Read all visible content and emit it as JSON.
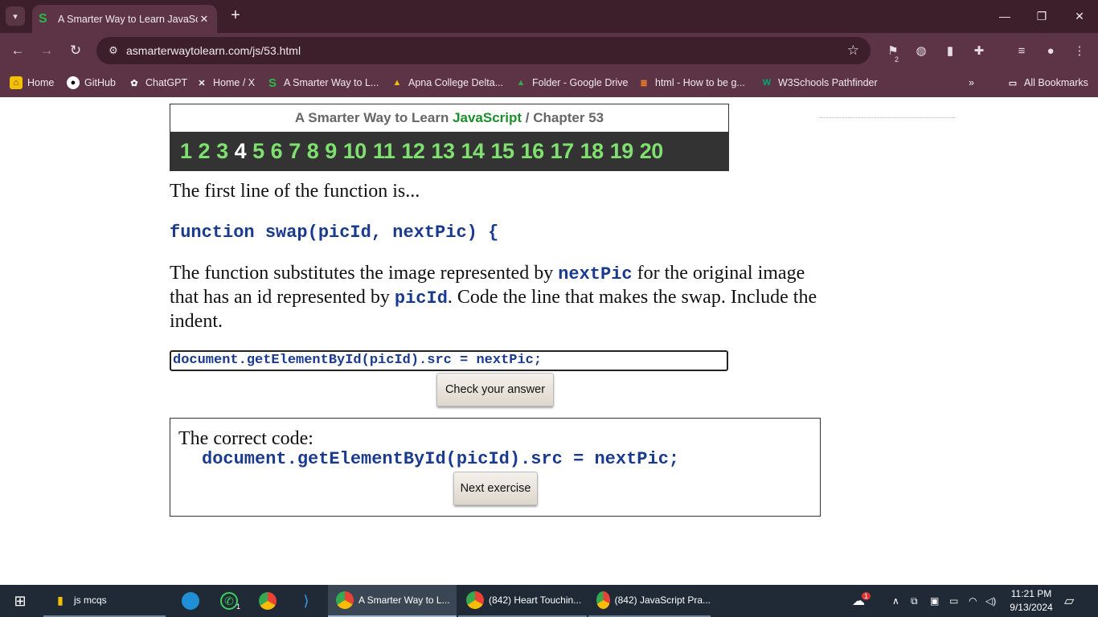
{
  "browser": {
    "tab": {
      "title": "A Smarter Way to Learn JavaScri",
      "favicon": "S"
    },
    "url": "asmarterwaytolearn.com/js/53.html",
    "bookmarks": [
      {
        "label": "Home",
        "icon": "home-icon"
      },
      {
        "label": "GitHub",
        "icon": "github-icon"
      },
      {
        "label": "ChatGPT",
        "icon": "chatgpt-icon"
      },
      {
        "label": "Home / X",
        "icon": "x-icon"
      },
      {
        "label": "A Smarter Way to L...",
        "icon": "smarter-way-icon"
      },
      {
        "label": "Apna College Delta...",
        "icon": "drive-icon"
      },
      {
        "label": "Folder - Google Drive",
        "icon": "drive-icon"
      },
      {
        "label": "html - How to be g...",
        "icon": "stackoverflow-icon"
      },
      {
        "label": "W3Schools Pathfinder",
        "icon": "w3schools-icon"
      }
    ],
    "all_bookmarks": "All Bookmarks",
    "extension_badge": "2"
  },
  "page": {
    "header_prefix": "A Smarter Way to Learn ",
    "header_js": "JavaScript",
    "header_sep": " / ",
    "header_chapter": "Chapter 53",
    "chapters": [
      "1",
      "2",
      "3",
      "4",
      "5",
      "6",
      "7",
      "8",
      "9",
      "10",
      "11",
      "12",
      "13",
      "14",
      "15",
      "16",
      "17",
      "18",
      "19",
      "20"
    ],
    "current_chapter": "4",
    "lead": "The first line of the function is...",
    "code_line": "function swap(picId, nextPic) {",
    "question_part1": "The function substitutes the image represented by ",
    "question_mono1": "nextPic",
    "question_part2": " for the original image that has an id represented by ",
    "question_mono2": "picId",
    "question_part3": ". Code the line that makes the swap. Include the indent.",
    "answer_value": "document.getElementById(picId).src = nextPic;",
    "check_button": "Check your answer",
    "result_label": "The correct code:",
    "result_code": "document.getElementById(picId).src = nextPic;",
    "next_button": "Next exercise"
  },
  "taskbar": {
    "items": [
      {
        "label": "js mcqs",
        "icon": "folder-icon"
      },
      {
        "label": "A Smarter Way to L...",
        "icon": "chrome-icon"
      },
      {
        "label": "(842) Heart Touchin...",
        "icon": "chrome-icon"
      },
      {
        "label": "(842) JavaScript Pra...",
        "icon": "chrome-icon"
      }
    ],
    "whatsapp_badge": "1",
    "weather_badge": "1",
    "time": "11:21 PM",
    "date": "9/13/2024"
  },
  "colors": {
    "chrome_dark": "#3c1f2b",
    "chrome_mid": "#5c3446",
    "chapter_green": "#7fe070",
    "code_blue": "#1a3a8f",
    "js_green": "#1a8f2a",
    "taskbar": "#1f2a36"
  }
}
